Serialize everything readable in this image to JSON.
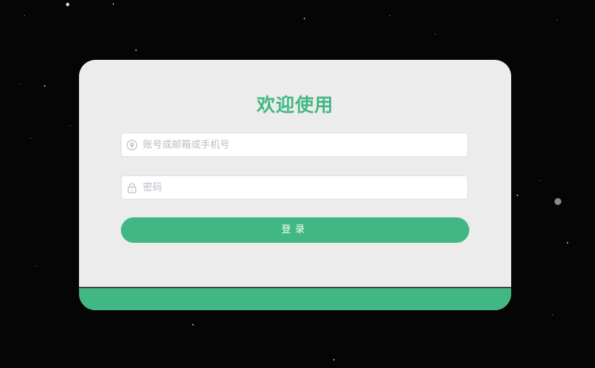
{
  "login": {
    "title": "欢迎使用",
    "username": {
      "placeholder": "账号或邮箱或手机号",
      "value": "",
      "icon": "user-icon"
    },
    "password": {
      "placeholder": "密码",
      "value": "",
      "icon": "lock-icon"
    },
    "submit_label": "登录"
  },
  "colors": {
    "accent": "#41b883",
    "background": "#050505",
    "card": "#ececec"
  }
}
